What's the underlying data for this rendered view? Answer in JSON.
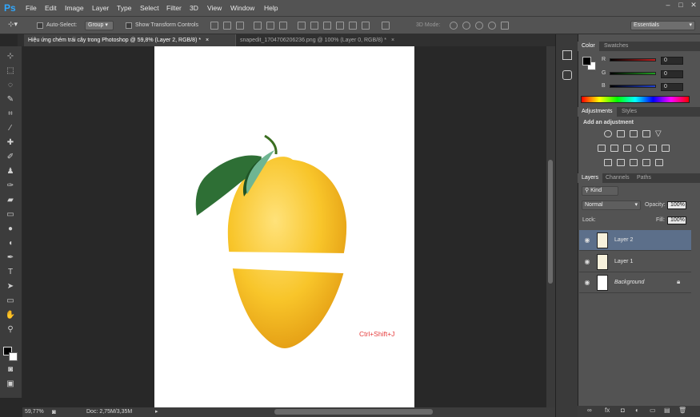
{
  "menubar": {
    "logo": "Ps",
    "items": [
      "File",
      "Edit",
      "Image",
      "Layer",
      "Type",
      "Select",
      "Filter",
      "3D",
      "View",
      "Window",
      "Help"
    ],
    "window_buttons": [
      "–",
      "□",
      "✕"
    ]
  },
  "options_bar": {
    "auto_select_label": "Auto-Select:",
    "auto_select_value": "Group",
    "show_transform_label": "Show Transform Controls",
    "mode_3d_label": "3D Mode:",
    "workspace": "Essentials"
  },
  "tabs": [
    {
      "label": "Hiệu ứng chém trái cây trong Photoshop @ 59,8% (Layer 2, RGB/8) *",
      "close": "×"
    },
    {
      "label": "snapedit_1704706206236.png @ 100% (Layer 0, RGB/8) *",
      "close": "×"
    }
  ],
  "canvas": {
    "hint_text": "Ctrl+Shift+J"
  },
  "status": {
    "zoom": "59,77%",
    "doc_size": "Doc: 2,75M/3,35M"
  },
  "color_panel": {
    "tabs": [
      "Color",
      "Swatches"
    ],
    "channels": [
      {
        "label": "R",
        "value": "0",
        "color": "#c22020"
      },
      {
        "label": "G",
        "value": "0",
        "color": "#20a020"
      },
      {
        "label": "B",
        "value": "0",
        "color": "#2040d0"
      }
    ]
  },
  "adjustments_panel": {
    "tabs": [
      "Adjustments",
      "Styles"
    ],
    "heading": "Add an adjustment"
  },
  "layers_panel": {
    "tabs": [
      "Layers",
      "Channels",
      "Paths"
    ],
    "filter_kind": "Kind",
    "blend_mode": "Normal",
    "opacity_label": "Opacity:",
    "opacity_value": "100%",
    "lock_label": "Lock:",
    "fill_label": "Fill:",
    "fill_value": "100%",
    "layers": [
      {
        "name": "Layer 2",
        "selected": true
      },
      {
        "name": "Layer 1",
        "selected": false
      },
      {
        "name": "Background",
        "selected": false,
        "locked": true
      }
    ]
  }
}
